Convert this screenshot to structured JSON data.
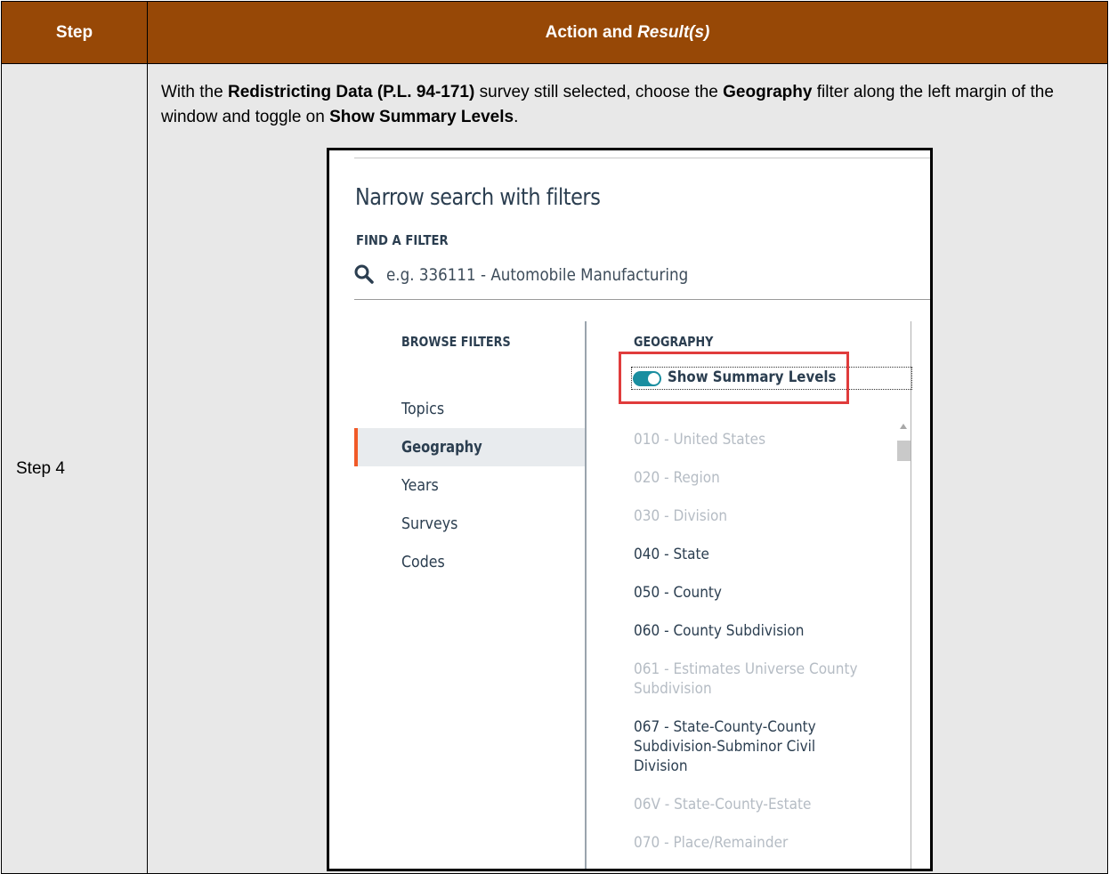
{
  "table": {
    "header_step": "Step",
    "header_action": "Action and ",
    "header_result": "Result(s)",
    "step_label": "Step 4",
    "instruction": {
      "p1": "With the ",
      "b1": "Redistricting Data (P.L. 94-171)",
      "p2": " survey still selected, choose the ",
      "b2": "Geography",
      "p3": " filter along the left margin of the window and toggle on ",
      "b3": "Show Summary Levels",
      "p4": "."
    }
  },
  "screenshot": {
    "title": "Narrow search with filters",
    "find_filter_label": "FIND A FILTER",
    "search_placeholder": "e.g. 336111 - Automobile Manufacturing",
    "browse_filters_label": "BROWSE FILTERS",
    "nav": [
      "Topics",
      "Geography",
      "Years",
      "Surveys",
      "Codes"
    ],
    "active_nav": "Geography",
    "geography_label": "GEOGRAPHY",
    "toggle_label": "Show Summary Levels",
    "toggle_on": true,
    "geo_items": [
      {
        "label": "010 - United States",
        "enabled": false
      },
      {
        "label": "020 - Region",
        "enabled": false
      },
      {
        "label": "030 - Division",
        "enabled": false
      },
      {
        "label": "040 - State",
        "enabled": true
      },
      {
        "label": "050 - County",
        "enabled": true
      },
      {
        "label": "060 - County Subdivision",
        "enabled": true
      },
      {
        "label": "061 - Estimates Universe County Subdivision",
        "enabled": false
      },
      {
        "label": "067 - State-County-County Subdivision-Subminor Civil Division",
        "enabled": true
      },
      {
        "label": "06V - State-County-Estate",
        "enabled": false
      },
      {
        "label": "070 - Place/Remainder",
        "enabled": false
      }
    ],
    "colors": {
      "accent": "#1a8ea0",
      "active_indicator": "#f05a28",
      "highlight": "#e03c3c",
      "header_bg": "#974806"
    }
  }
}
